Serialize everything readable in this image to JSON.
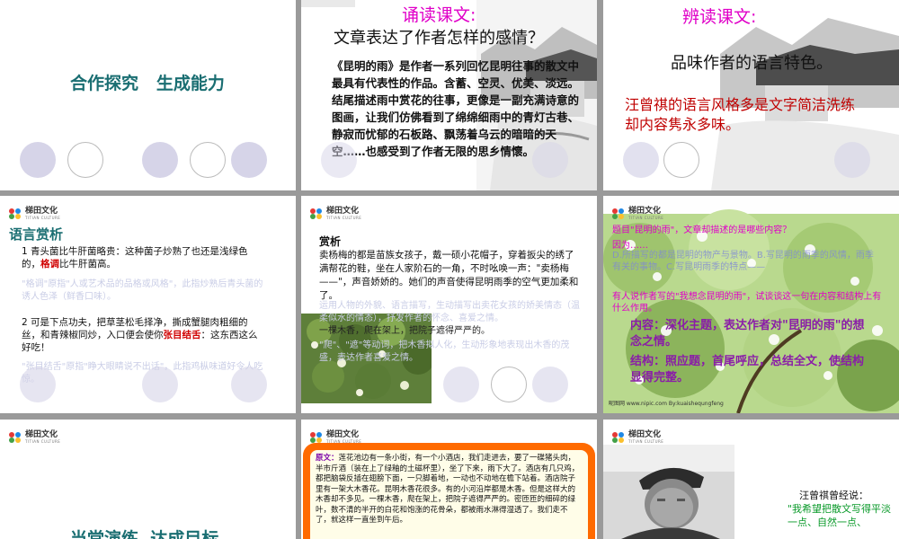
{
  "brand": {
    "name": "梯田文化",
    "sub": "TITIAN CULTURE"
  },
  "slide1": {
    "title": "合作探究   生成能力"
  },
  "slide2": {
    "heading": "诵读课文:",
    "question": "文章表达了作者怎样的感情？",
    "body": "《昆明的雨》是作者一系列回忆昆明往事的散文中最具有代表性的作品。含蓄、空灵、优美、淡远。结尾描述雨中赏花的往事，更像是一副充满诗意的图画，让我们仿佛看到了绵绵细雨中的青灯古巷、静寂而忧郁的石板路、飘荡着乌云的暗暗的天空……也感受到了作者无限的思乡情懷。"
  },
  "slide3": {
    "heading": "辨读课文:",
    "question": "品味作者的语言特色。",
    "answer": "汪曾祺的语言风格多是文字简洁洗练却内容隽永多味。"
  },
  "slide4": {
    "title": "语言赏析",
    "p1a": "1 青头菌比牛肝菌略贵：这种菌子炒熟了也还是浅绿色的，",
    "p1hl": "格调",
    "p1b": "比牛肝菌高。",
    "f1": "\"格调\"原指\"人或艺术品的品格或风格\"，此指炒熟后青头菌的诱人色泽（鲜香口味）。",
    "p2a": "2 可是下点功夫，把草茎松毛择净，撕成蟹腿肉粗细的丝，和青辣椒同炒，入口便会使你",
    "p2hl": "张目结舌",
    "p2b": "：这东西这么好吃！",
    "f2": "\"张目结舌\"原指\"睁大眼睛说不出话\"，此指鸡枞味道好令人吃惊。"
  },
  "slide5": {
    "title": "赏析",
    "body": "卖杨梅的都是苗族女孩子，戴一硕小花帽子，穿着扳尖的绣了满帮花的鞋，坐在人家阶石的一角，不时吆唤一声：\"卖杨梅——\"，声音娇娇的。她们的声音使得昆明雨季的空气更加柔和了。",
    "f1": "运用人物的外貌、语言描写，生动描写出卖花女孩的娇美情态（温柔似水的情态），抒发作者的怀念、喜爱之情。",
    "f2": "一棵木香，爬在架上，把院子遮得严严的。",
    "f3": "\"爬\"、\"遮\"等动词，把木香拟人化，生动形象地表现出木香的茂盛，表达作者喜爱之情。"
  },
  "slide6": {
    "line1": "题目\"昆明的雨\"，文章却描述的是哪些内容？",
    "line2": "因为……",
    "faint": "D.所描写的都是昆明的物产与景物。B.写昆明的雨季的风情，雨季有关的事物。C.写昆明雨季的特点——",
    "line3": "有人说作者写的\"我想念昆明的雨\"，试谈谈这一句在内容和结构上有什么作用。",
    "p1": "内容：深化主题，表达作者对\"昆明的雨\"的想念之情。",
    "p2": "结构：照应题，首尾呼应，总结全文，使结构显得完整。",
    "credit": "昵图网 www.nipic.com  By:kuaishequngfeng"
  },
  "slide7": {
    "title": "当堂演练  达成目标"
  },
  "slide8": {
    "label": "原文：",
    "body": "莲花池边有一条小街，有一个小酒店，我们走进去，要了一碟猪头肉，半市斤酒（装在上了绿釉的土磁杯里），坐了下来，雨下大了。酒店有几只鸡，都把脑袋反插在翅膀下面，一只脚着地，一动也不动地在檐下站着。酒店院子里有一架大木香花。昆明木香花很多。有的小河沿岸都是木香。但是这样大的木香却不多见。一棵木香，爬在架上，把院子遮得严严的。密匝匝的细碎的绿叶，数不清的半开的白花和饱涨的花骨朵，都被雨水淋得湿透了。我们走不了，就这样一直坐到午后。"
  },
  "slide9": {
    "intro": "汪曾祺曾经说：",
    "quote": "\"我希望把散文写得平淡一点、自然一点、"
  },
  "colors": {
    "title_green": "#1a6e72",
    "magenta": "#e000c8",
    "red": "#c00000",
    "purple": "#8a1ca8",
    "orange": "#ff6a00",
    "circle_fill": "#d6d4e8"
  }
}
